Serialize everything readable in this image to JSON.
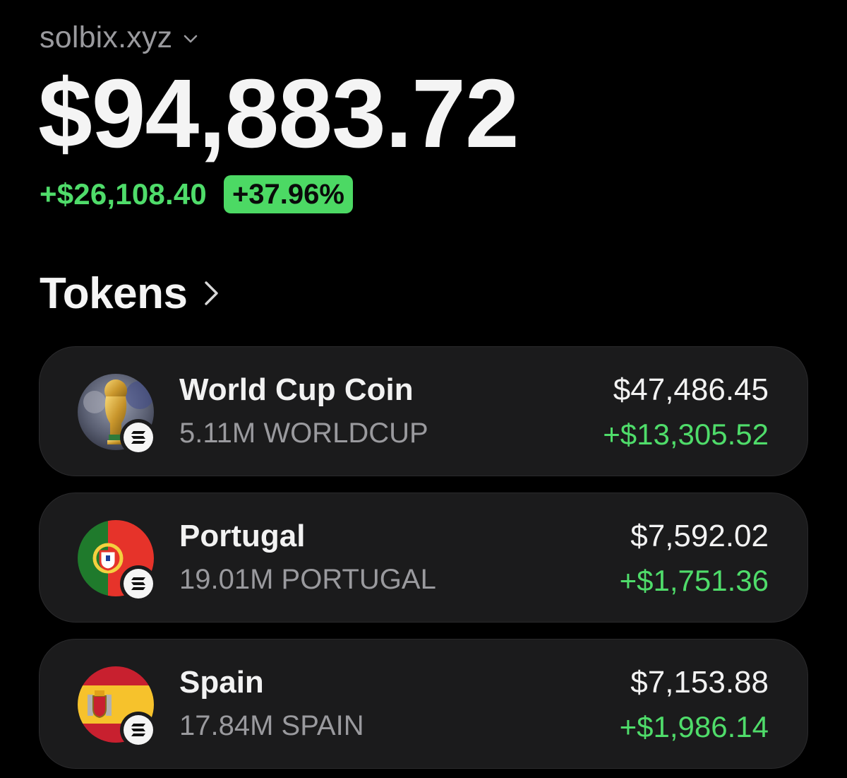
{
  "account": {
    "name": "solbix.xyz",
    "chevron_icon": "chevron-down-icon"
  },
  "portfolio": {
    "balance": "$94,883.72",
    "change_amount": "+$26,108.40",
    "change_percent": "+37.96%"
  },
  "tokens_section": {
    "title": "Tokens",
    "chevron_icon": "chevron-right-icon"
  },
  "tokens": [
    {
      "name": "World Cup Coin",
      "amount": "5.11M WORLDCUP",
      "value": "$47,486.45",
      "gain": "+$13,305.52",
      "logo_icon": "world-cup-trophy-icon",
      "chain_icon": "solana-icon"
    },
    {
      "name": "Portugal",
      "amount": "19.01M PORTUGAL",
      "value": "$7,592.02",
      "gain": "+$1,751.36",
      "logo_icon": "portugal-flag-icon",
      "chain_icon": "solana-icon"
    },
    {
      "name": "Spain",
      "amount": "17.84M SPAIN",
      "value": "$7,153.88",
      "gain": "+$1,986.14",
      "logo_icon": "spain-flag-icon",
      "chain_icon": "solana-icon"
    }
  ],
  "colors": {
    "background": "#000000",
    "card": "#1b1b1c",
    "gain_green": "#4fdc6a",
    "badge_green": "#4cd964",
    "muted_text": "#9a9a9e"
  }
}
